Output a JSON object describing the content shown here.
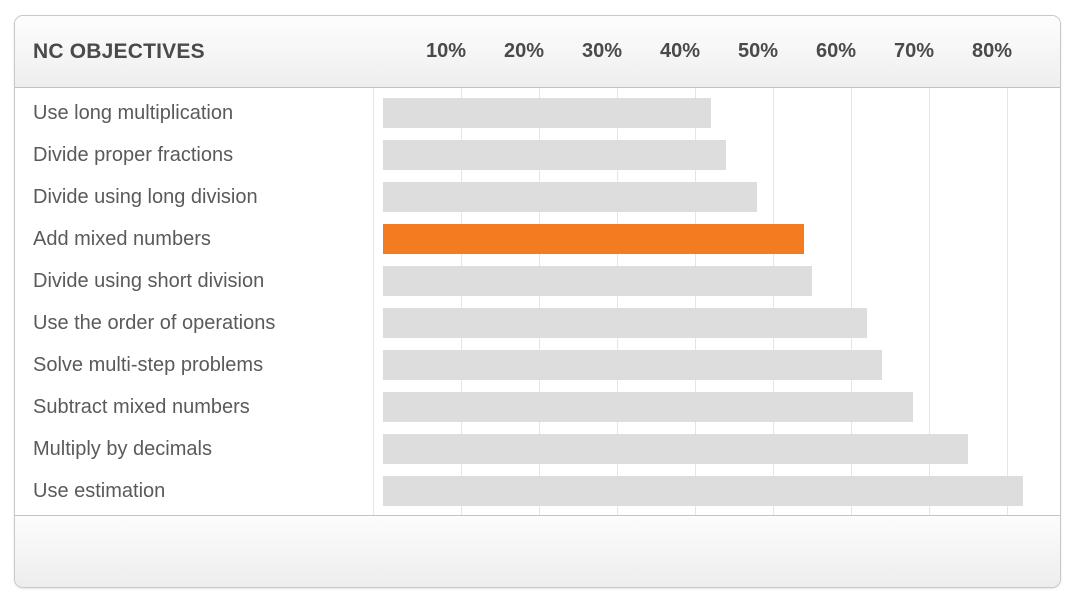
{
  "header": {
    "title": "NC OBJECTIVES",
    "axis_ticks": [
      "10%",
      "20%",
      "30%",
      "40%",
      "50%",
      "60%",
      "70%",
      "80%"
    ]
  },
  "colors": {
    "bar": "#dddddd",
    "bar_highlight": "#f47c20",
    "label_text": "#5a5a5a",
    "header_text": "#4a4a4a",
    "gridline": "#e3e6e8",
    "panel_border": "#c8c8c8"
  },
  "chart_data": {
    "type": "bar",
    "orientation": "horizontal",
    "title": "NC OBJECTIVES",
    "xlabel": "",
    "ylabel": "",
    "xlim": [
      0,
      85
    ],
    "xticks": [
      10,
      20,
      30,
      40,
      50,
      60,
      70,
      80
    ],
    "xtick_labels": [
      "10%",
      "20%",
      "30%",
      "40%",
      "50%",
      "60%",
      "70%",
      "80%"
    ],
    "grid": true,
    "legend": "none",
    "value_unit": "%",
    "highlight_index": 3,
    "categories": [
      "Use long multiplication",
      "Divide proper fractions",
      "Divide using long division",
      "Add mixed numbers",
      "Divide using short division",
      "Use the order of operations",
      "Solve multi-step problems",
      "Subtract mixed numbers",
      "Multiply by decimals",
      "Use estimation"
    ],
    "values": [
      42,
      44,
      48,
      54,
      55,
      62,
      64,
      68,
      75,
      82
    ],
    "bars": [
      {
        "label": "Use long multiplication",
        "value": 42,
        "highlighted": false
      },
      {
        "label": "Divide proper fractions",
        "value": 44,
        "highlighted": false
      },
      {
        "label": "Divide using long division",
        "value": 48,
        "highlighted": false
      },
      {
        "label": "Add mixed numbers",
        "value": 54,
        "highlighted": true
      },
      {
        "label": "Divide using short division",
        "value": 55,
        "highlighted": false
      },
      {
        "label": "Use the order of operations",
        "value": 62,
        "highlighted": false
      },
      {
        "label": "Solve multi-step problems",
        "value": 64,
        "highlighted": false
      },
      {
        "label": "Subtract mixed numbers",
        "value": 68,
        "highlighted": false
      },
      {
        "label": "Multiply by decimals",
        "value": 75,
        "highlighted": false
      },
      {
        "label": "Use estimation",
        "value": 82,
        "highlighted": false
      }
    ]
  }
}
